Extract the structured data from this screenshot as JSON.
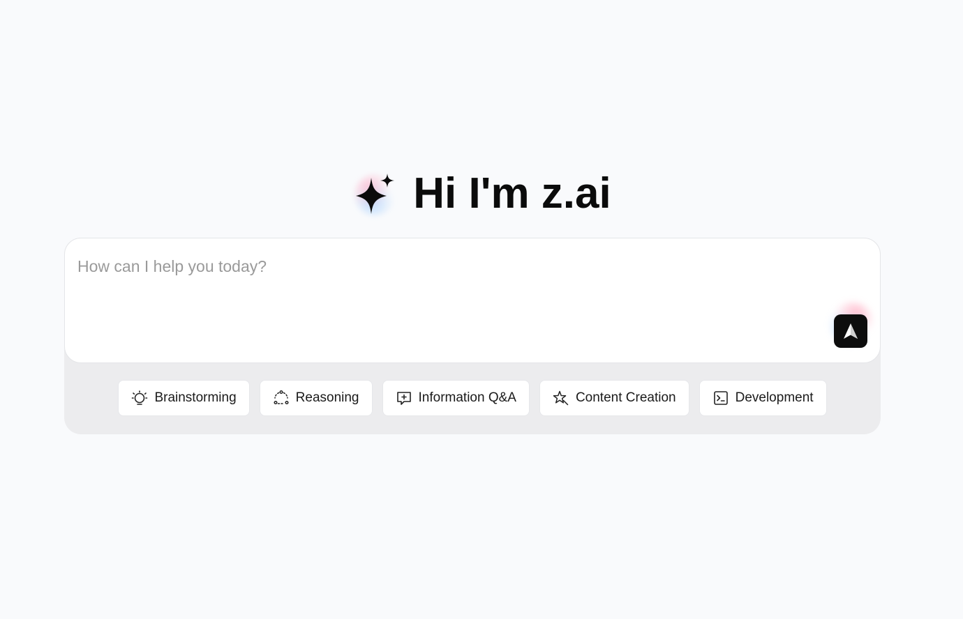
{
  "hero": {
    "title": "Hi I'm z.ai",
    "icon": "sparkle-icon"
  },
  "composer": {
    "input_value": "",
    "placeholder": "How can I help you today?",
    "send_icon": "send-arrow-icon"
  },
  "chips": [
    {
      "label": "Brainstorming",
      "icon": "lightbulb-icon"
    },
    {
      "label": "Reasoning",
      "icon": "reasoning-icon"
    },
    {
      "label": "Information Q&A",
      "icon": "chat-plus-icon"
    },
    {
      "label": "Content Creation",
      "icon": "pen-sparkle-icon"
    },
    {
      "label": "Development",
      "icon": "terminal-icon"
    }
  ],
  "colors": {
    "background": "#f9fafc",
    "composer_tray": "#ececee",
    "send_button": "#0d0d0d"
  }
}
